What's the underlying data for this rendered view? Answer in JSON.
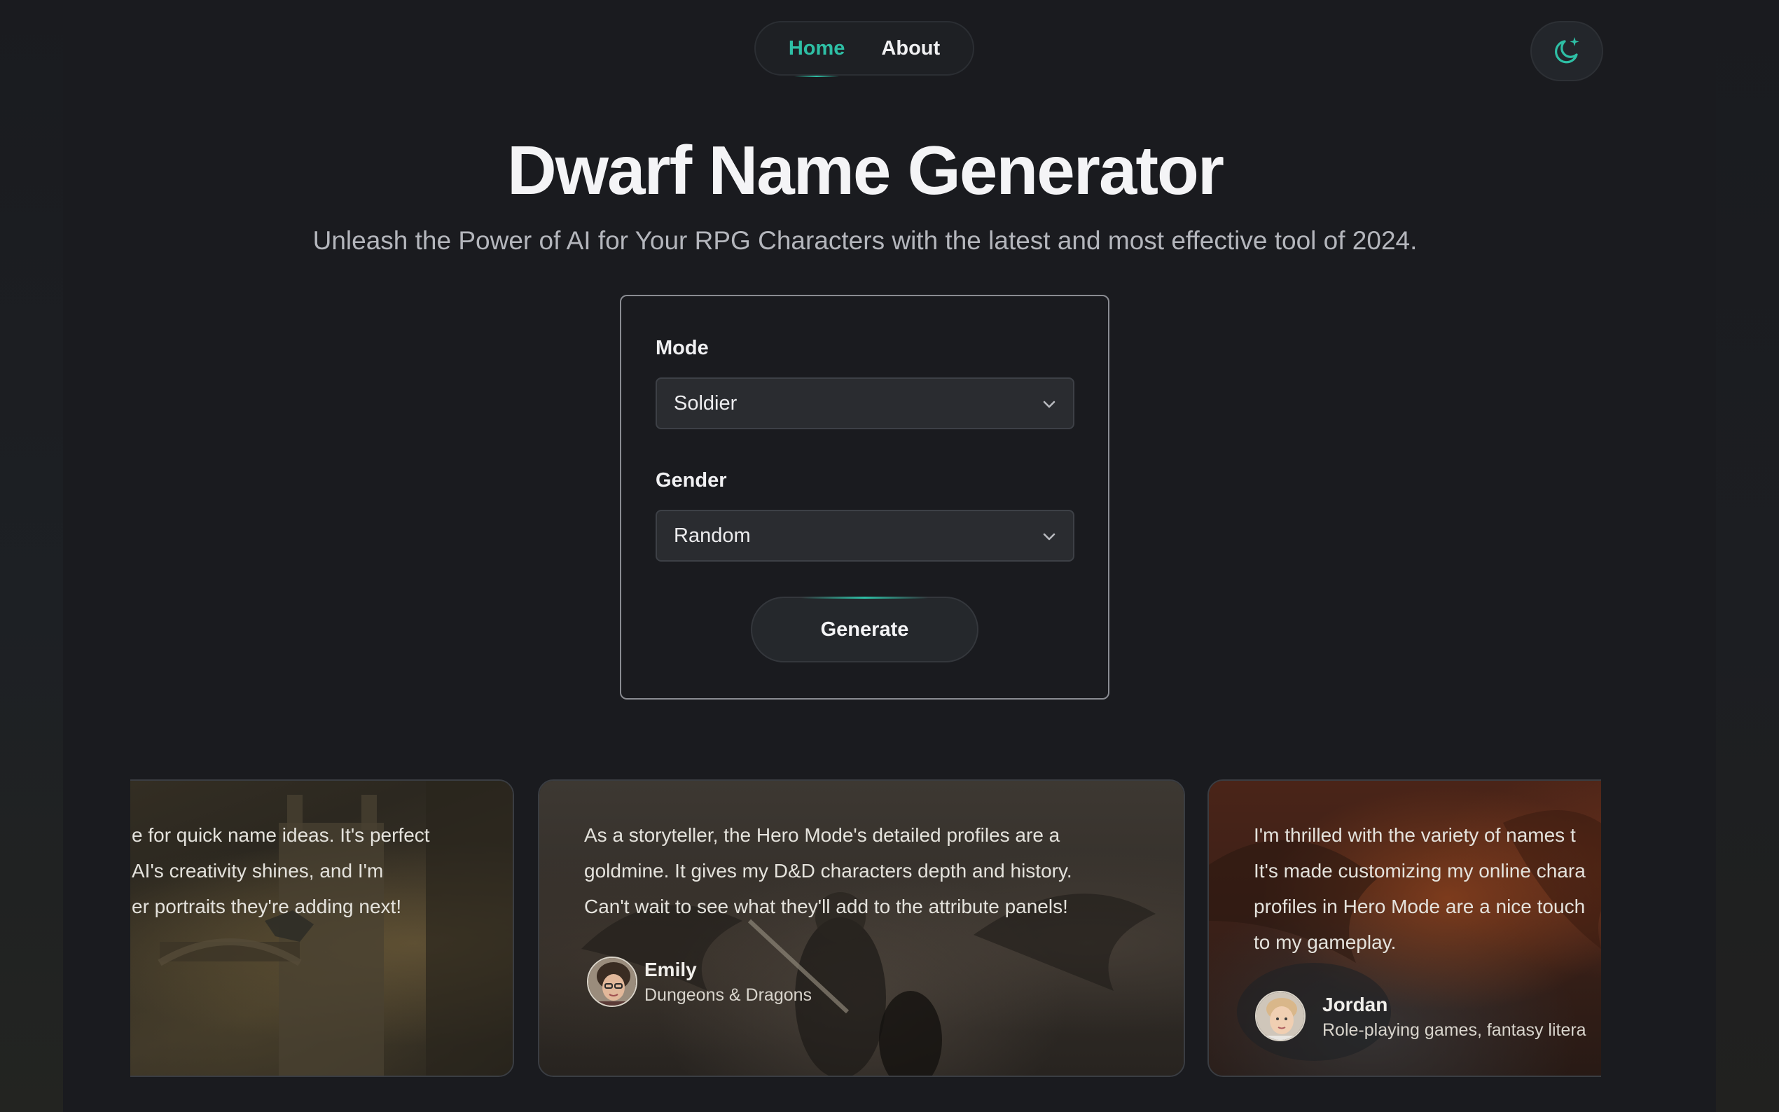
{
  "nav": {
    "items": [
      {
        "label": "Home",
        "active": true
      },
      {
        "label": "About",
        "active": false
      }
    ]
  },
  "theme_toggle": {
    "icon": "moon-sparkle-icon"
  },
  "hero": {
    "title": "Dwarf Name Generator",
    "subtitle": "Unleash the Power of AI for Your RPG Characters with the latest and most effective tool of 2024."
  },
  "form": {
    "mode_label": "Mode",
    "mode_value": "Soldier",
    "gender_label": "Gender",
    "gender_value": "Random",
    "generate_label": "Generate"
  },
  "testimonials": [
    {
      "quote": "e for quick name ideas. It's perfect\nAI's creativity shines, and I'm\ner portraits they're adding next!"
    },
    {
      "quote": "As a storyteller, the Hero Mode's detailed profiles are a\ngoldmine. It gives my D&D characters depth and history.\nCan't wait to see what they'll add to the attribute panels!",
      "name": "Emily",
      "role": "Dungeons & Dragons"
    },
    {
      "quote": "I'm thrilled with the variety of names t\nIt's made customizing my online chara\nprofiles in Hero Mode are a nice touch\nto my gameplay.",
      "name": "Jordan",
      "role": "Role-playing games, fantasy litera"
    }
  ],
  "colors": {
    "accent": "#2ebfa5",
    "background": "#1a1b1f"
  }
}
